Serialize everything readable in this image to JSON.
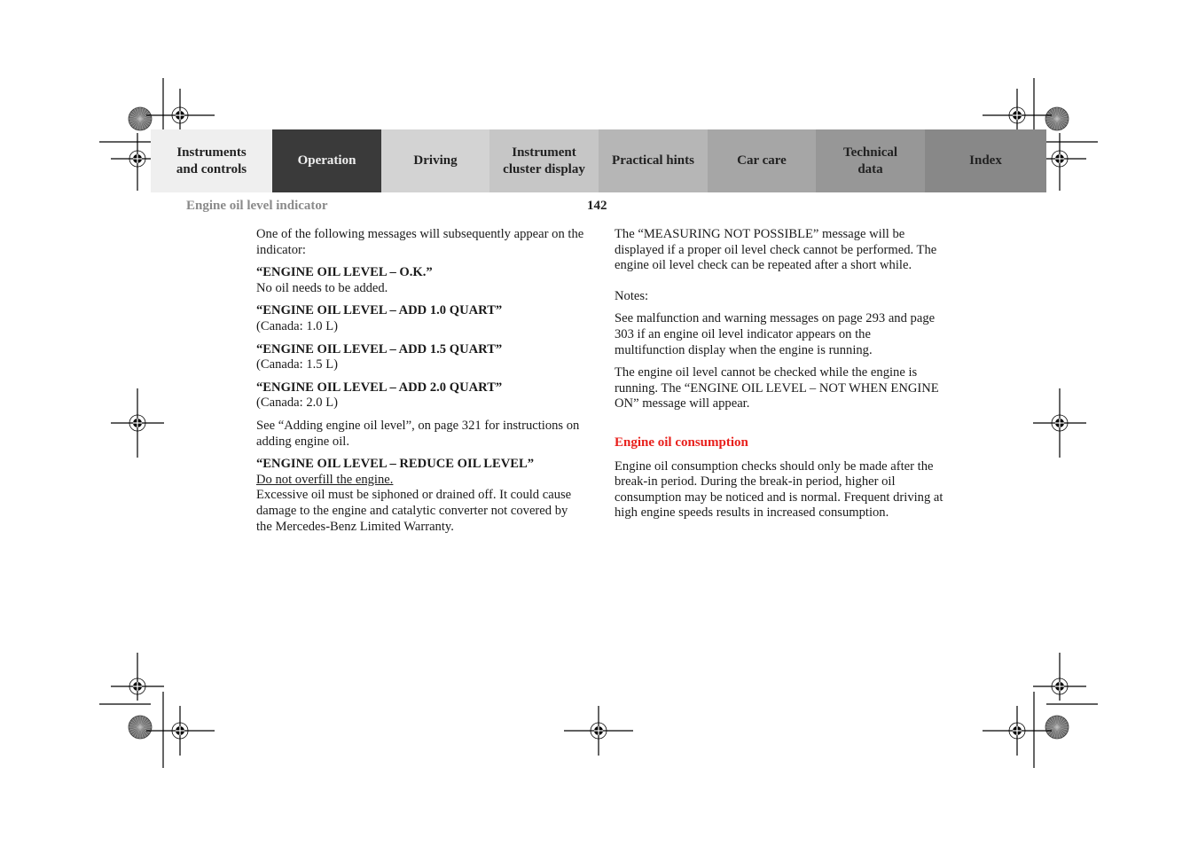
{
  "nav": {
    "tabs": [
      {
        "line1": "Instruments",
        "line2": "and controls",
        "active": false
      },
      {
        "line1": "Operation",
        "line2": "",
        "active": true
      },
      {
        "line1": "Driving",
        "line2": "",
        "active": false
      },
      {
        "line1": "Instrument",
        "line2": "cluster display",
        "active": false
      },
      {
        "line1": "Practical hints",
        "line2": "",
        "active": false
      },
      {
        "line1": "Car care",
        "line2": "",
        "active": false
      },
      {
        "line1": "Technical",
        "line2": "data",
        "active": false
      },
      {
        "line1": "Index",
        "line2": "",
        "active": false
      }
    ]
  },
  "header": {
    "section_title": "Engine oil level indicator",
    "page_number": "142"
  },
  "left_column": {
    "intro": "One of the following messages will subsequently appear on the indicator:",
    "msg_ok_title": "“ENGINE OIL LEVEL – O.K.”",
    "msg_ok_text": "No oil needs to be added.",
    "msg_add10_title": "“ENGINE OIL LEVEL – ADD 1.0 QUART”",
    "msg_add10_text": "(Canada: 1.0 L)",
    "msg_add15_title": "“ENGINE OIL LEVEL – ADD 1.5 QUART”",
    "msg_add15_text": "(Canada: 1.5 L)",
    "msg_add20_title": "“ENGINE OIL LEVEL – ADD 2.0 QUART”",
    "msg_add20_text": "(Canada: 2.0 L)",
    "see_adding": "See “Adding engine oil level”, on page 321 for instructions on adding engine oil.",
    "msg_reduce_title": "“ENGINE OIL LEVEL – REDUCE OIL LEVEL”",
    "msg_reduce_warning": "Do not overfill the engine.",
    "msg_reduce_text": "Excessive oil must be siphoned or drained off. It could cause damage to the engine and catalytic converter not covered by the Mercedes-Benz Limited Warranty."
  },
  "right_column": {
    "measuring": "The “MEASURING NOT POSSIBLE” message will be displayed if a proper oil level check cannot be performed. The engine oil level check can be repeated after a short while.",
    "notes_label": "Notes:",
    "note1": "See malfunction and warning messages on page 293 and page 303 if an engine oil level indicator appears on the multifunction display when the engine is running.",
    "note2": "The engine oil level cannot be checked while the engine is running. The “ENGINE OIL LEVEL – NOT WHEN ENGINE ON” message will appear.",
    "consumption_heading": "Engine oil consumption",
    "consumption_text": "Engine oil consumption checks should only be made after the break-in period. During the break-in period, higher oil consumption may be noticed and is normal. Frequent driving at high engine speeds results in increased consumption."
  },
  "colors": {
    "heading_accent": "#e8201c",
    "active_tab": "#3a3a3a"
  }
}
